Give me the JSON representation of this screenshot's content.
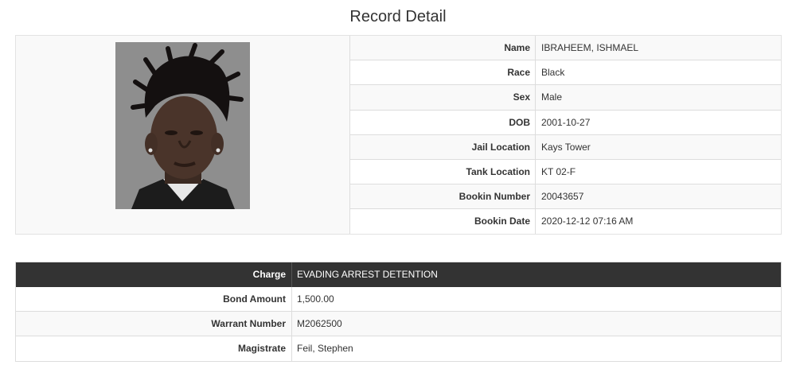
{
  "page": {
    "title": "Record Detail"
  },
  "record": {
    "fields": [
      {
        "label": "Name",
        "value": "IBRAHEEM, ISHMAEL"
      },
      {
        "label": "Race",
        "value": "Black"
      },
      {
        "label": "Sex",
        "value": "Male"
      },
      {
        "label": "DOB",
        "value": "2001-10-27"
      },
      {
        "label": "Jail Location",
        "value": "Kays Tower"
      },
      {
        "label": "Tank Location",
        "value": "KT 02-F"
      },
      {
        "label": "Bookin Number",
        "value": "20043657"
      },
      {
        "label": "Bookin Date",
        "value": "2020-12-12 07:16 AM"
      }
    ]
  },
  "charges": [
    {
      "label": "Charge",
      "value": "EVADING ARREST DETENTION"
    },
    {
      "label": "Bond Amount",
      "value": "1,500.00"
    },
    {
      "label": "Warrant Number",
      "value": "M2062500"
    },
    {
      "label": "Magistrate",
      "value": "Feil, Stephen"
    }
  ],
  "colors": {
    "header_bg": "#333333",
    "stripe": "#f9f9f9",
    "border": "#dddddd",
    "mugshot_bg": "#8f8f8f"
  }
}
